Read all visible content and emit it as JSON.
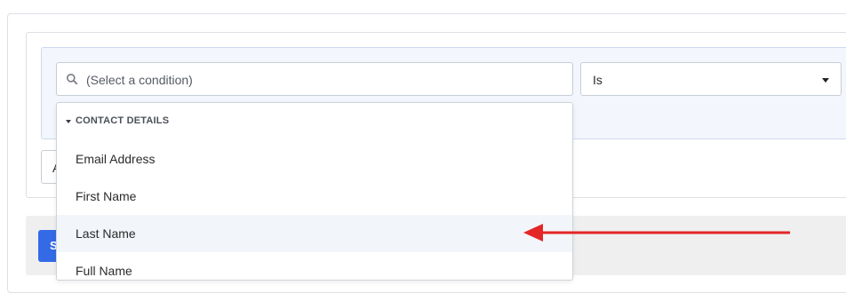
{
  "condition": {
    "search": {
      "placeholder": "(Select a condition)",
      "icon": "search-icon"
    },
    "operator": {
      "selected": "Is",
      "icon": "chevron-down-icon"
    }
  },
  "dropdown": {
    "group_label": "CONTACT DETAILS",
    "options": [
      "Email Address",
      "First Name",
      "Last Name",
      "Full Name"
    ],
    "highlighted_option": "Last Name"
  },
  "stub_button": {
    "label": "A"
  },
  "footer": {
    "button_label": "S"
  },
  "colors": {
    "annotation_arrow": "#e32626",
    "primary_button": "#356ae6",
    "row_highlight": "#f2f5fa",
    "condition_row_bg": "#f3f6fd"
  }
}
